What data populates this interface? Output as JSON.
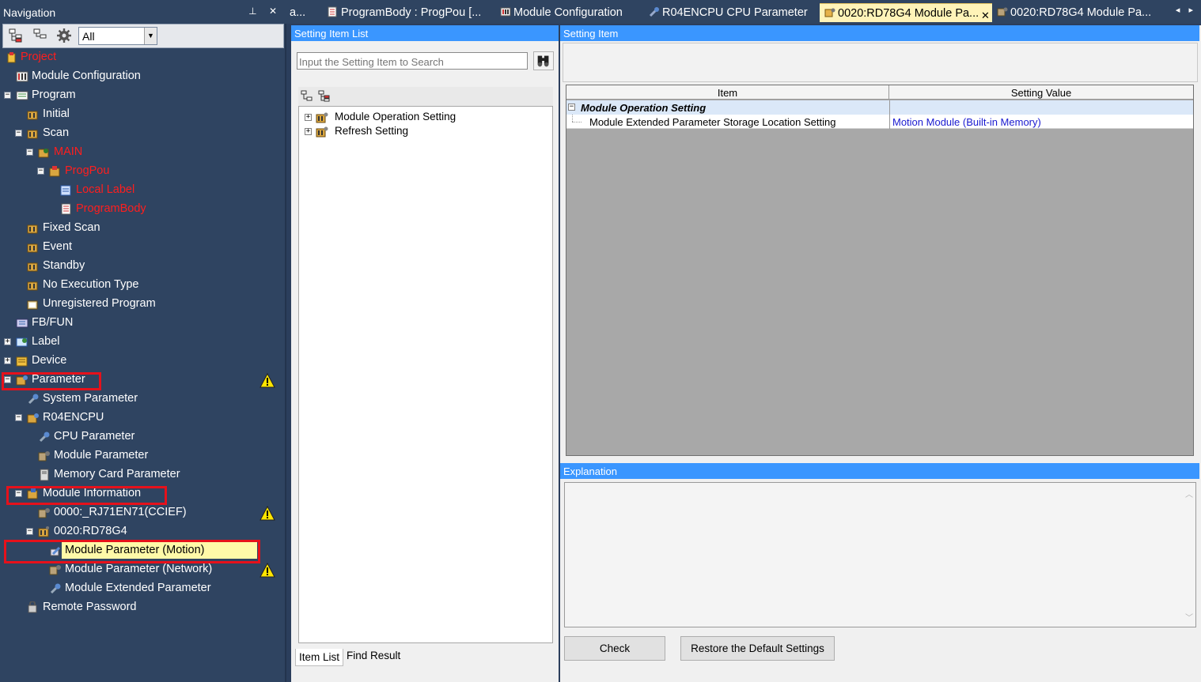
{
  "navigation": {
    "title": "Navigation",
    "pin_glyph": "⊥",
    "close_glyph": "✕",
    "filter_value": "All",
    "tree": [
      {
        "label": "Project",
        "red": true
      },
      {
        "label": "Module Configuration"
      },
      {
        "label": "Program"
      },
      {
        "label": "Initial"
      },
      {
        "label": "Scan"
      },
      {
        "label": "MAIN",
        "red": true
      },
      {
        "label": "ProgPou",
        "red": true
      },
      {
        "label": "Local Label",
        "red": true
      },
      {
        "label": "ProgramBody",
        "red": true
      },
      {
        "label": "Fixed Scan"
      },
      {
        "label": "Event"
      },
      {
        "label": "Standby"
      },
      {
        "label": "No Execution Type"
      },
      {
        "label": "Unregistered Program"
      },
      {
        "label": "FB/FUN"
      },
      {
        "label": "Label"
      },
      {
        "label": "Device"
      },
      {
        "label": "Parameter"
      },
      {
        "label": "System Parameter"
      },
      {
        "label": "R04ENCPU"
      },
      {
        "label": "CPU Parameter"
      },
      {
        "label": "Module Parameter"
      },
      {
        "label": "Memory Card Parameter"
      },
      {
        "label": "Module Information"
      },
      {
        "label": "0000:_RJ71EN71(CCIEF)"
      },
      {
        "label": "0020:RD78G4"
      },
      {
        "label": "Module Parameter (Motion)"
      },
      {
        "label": "Module Parameter (Network)"
      },
      {
        "label": "Module Extended Parameter"
      },
      {
        "label": "Remote Password"
      }
    ]
  },
  "tabs": [
    {
      "label": "a..."
    },
    {
      "label": "ProgramBody : ProgPou [..."
    },
    {
      "label": "Module Configuration"
    },
    {
      "label": "R04ENCPU CPU Parameter"
    },
    {
      "label": "0020:RD78G4 Module Pa...",
      "active": true
    },
    {
      "label": "0020:RD78G4 Module Pa..."
    }
  ],
  "tab_close_glyph": "✕",
  "setting_item_list": {
    "title": "Setting Item List",
    "search_placeholder": "Input the Setting Item to Search",
    "items": [
      "Module Operation Setting",
      "Refresh Setting"
    ],
    "bottom_tabs": [
      "Item List",
      "Find Result"
    ]
  },
  "setting_item": {
    "title": "Setting Item",
    "columns": [
      "Item",
      "Setting Value"
    ],
    "group": "Module Operation Setting",
    "rows": [
      {
        "item": "Module Extended Parameter Storage Location Setting",
        "value": "Motion Module (Built-in Memory)"
      }
    ]
  },
  "explanation": {
    "title": "Explanation"
  },
  "buttons": {
    "check": "Check",
    "restore": "Restore the Default Settings"
  },
  "colors": {
    "nav_bg": "#2f4461",
    "panel_title": "#3a96ff",
    "highlight_box": "#e6111b",
    "selected_item": "#fff9a8",
    "active_tab": "#fff3b8"
  }
}
